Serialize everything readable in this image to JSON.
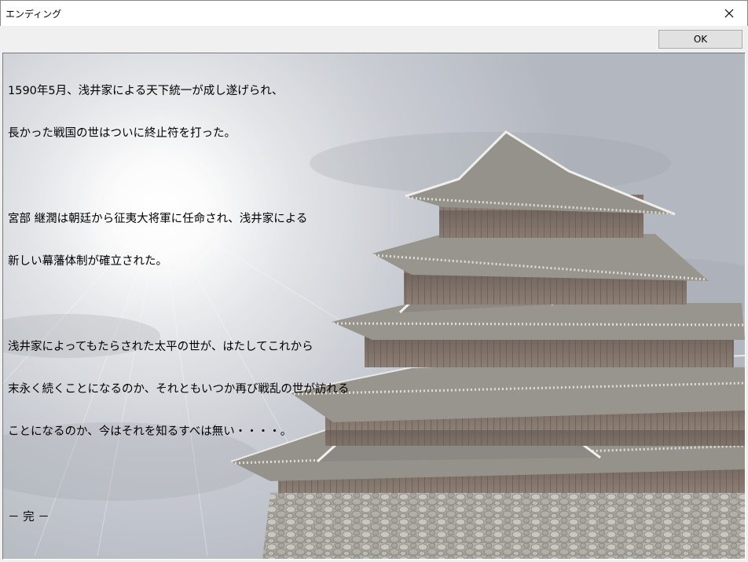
{
  "window": {
    "title": "エンディング",
    "close_icon": "close-icon"
  },
  "toolbar": {
    "ok_label": "OK"
  },
  "story": {
    "paragraph1": [
      "1590年5月、浅井家による天下統一が成し遂げられ、",
      "長かった戦国の世はついに終止符を打った。"
    ],
    "paragraph2": [
      "宮部 継潤は朝廷から征夷大将軍に任命され、浅井家による",
      "新しい幕藩体制が確立された。"
    ],
    "paragraph3": [
      "浅井家によってもたらされた太平の世が、はたしてこれから",
      "末永く続くことになるのか、それともいつか再び戦乱の世が訪れる",
      "ことになるのか、今はそれを知るすべは無い・・・・。"
    ],
    "ending": "－ 完 －"
  },
  "scene": {
    "image": "castle-illustration",
    "colors": {
      "sky": "#b9bfc8",
      "sun_glow": "#ffffff",
      "roof": "#807c77",
      "wall": "#6e5e52",
      "stone": "#a19d96"
    }
  }
}
